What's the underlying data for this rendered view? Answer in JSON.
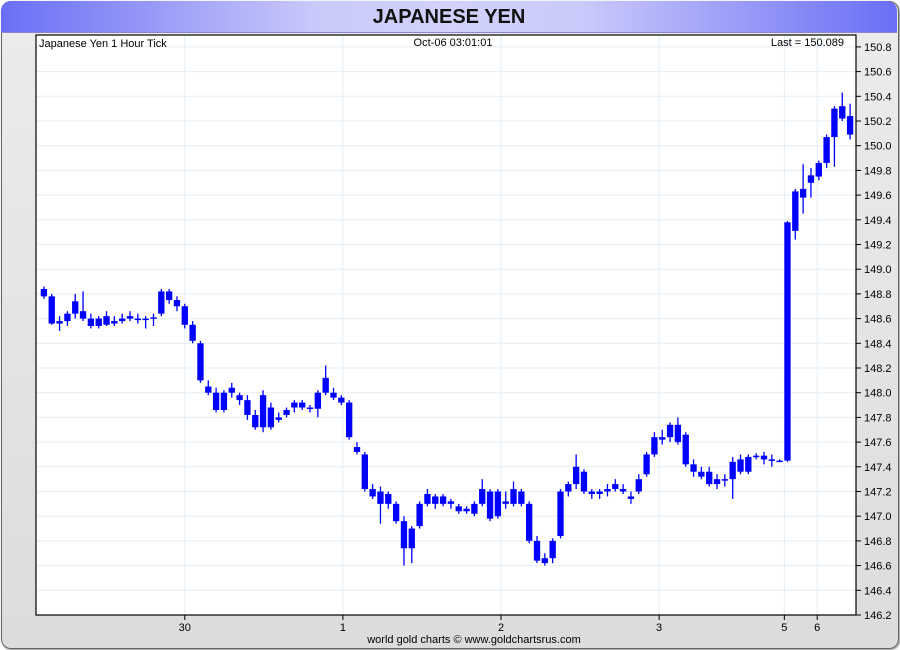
{
  "title": "JAPANESE YEN",
  "chart_data": {
    "type": "candlestick",
    "title": "Japanese Yen 1 Hour Tick",
    "timestamp": "Oct-06  03:01:01",
    "last_label": "Last = 150.089",
    "footer": "world gold charts © www.goldchartsrus.com",
    "ylim": [
      146.2,
      150.9
    ],
    "yticks": [
      "146.2",
      "146.4",
      "146.6",
      "146.8",
      "147.0",
      "147.2",
      "147.4",
      "147.6",
      "147.8",
      "148.0",
      "148.2",
      "148.4",
      "148.6",
      "148.8",
      "149.0",
      "149.2",
      "149.4",
      "149.6",
      "149.8",
      "150.0",
      "150.2",
      "150.4",
      "150.6",
      "150.8"
    ],
    "xticks": [
      {
        "label": "30",
        "index": 18
      },
      {
        "label": "1",
        "index": 38.2
      },
      {
        "label": "2",
        "index": 58.4
      },
      {
        "label": "3",
        "index": 78.6
      },
      {
        "label": "5",
        "index": 94.6
      },
      {
        "label": "6",
        "index": 98.8
      }
    ],
    "color": "#0000ff",
    "candles": [
      [
        148.84,
        148.86,
        148.76,
        148.78
      ],
      [
        148.78,
        148.8,
        148.55,
        148.56
      ],
      [
        148.56,
        148.62,
        148.5,
        148.58
      ],
      [
        148.58,
        148.66,
        148.54,
        148.64
      ],
      [
        148.64,
        148.8,
        148.6,
        148.74
      ],
      [
        148.66,
        148.82,
        148.58,
        148.6
      ],
      [
        148.6,
        148.64,
        148.52,
        148.54
      ],
      [
        148.54,
        148.62,
        148.52,
        148.6
      ],
      [
        148.62,
        148.66,
        148.54,
        148.55
      ],
      [
        148.56,
        148.62,
        148.54,
        148.58
      ],
      [
        148.58,
        148.64,
        148.56,
        148.6
      ],
      [
        148.6,
        148.66,
        148.58,
        148.62
      ],
      [
        148.6,
        148.64,
        148.56,
        148.6
      ],
      [
        148.6,
        148.62,
        148.52,
        148.6
      ],
      [
        148.6,
        148.64,
        148.54,
        148.61
      ],
      [
        148.64,
        148.84,
        148.62,
        148.82
      ],
      [
        148.82,
        148.84,
        148.72,
        148.75
      ],
      [
        148.75,
        148.78,
        148.66,
        148.7
      ],
      [
        148.7,
        148.72,
        148.52,
        148.55
      ],
      [
        148.55,
        148.58,
        148.4,
        148.42
      ],
      [
        148.4,
        148.42,
        148.08,
        148.1
      ],
      [
        148.05,
        148.1,
        147.98,
        148.0
      ],
      [
        148.0,
        148.04,
        147.84,
        147.86
      ],
      [
        147.86,
        148.02,
        147.84,
        148.0
      ],
      [
        148.0,
        148.08,
        147.96,
        148.04
      ],
      [
        147.98,
        148.0,
        147.9,
        147.94
      ],
      [
        147.94,
        147.98,
        147.78,
        147.82
      ],
      [
        147.82,
        147.86,
        147.7,
        147.72
      ],
      [
        147.98,
        148.02,
        147.68,
        147.72
      ],
      [
        147.72,
        147.92,
        147.7,
        147.88
      ],
      [
        147.78,
        147.84,
        147.76,
        147.8
      ],
      [
        147.82,
        147.88,
        147.8,
        147.86
      ],
      [
        147.88,
        147.94,
        147.84,
        147.92
      ],
      [
        147.92,
        147.94,
        147.86,
        147.88
      ],
      [
        147.88,
        147.9,
        147.84,
        147.87
      ],
      [
        147.87,
        148.02,
        147.8,
        148.0
      ],
      [
        148.0,
        148.22,
        147.98,
        148.12
      ],
      [
        148.0,
        148.04,
        147.94,
        147.96
      ],
      [
        147.96,
        147.98,
        147.9,
        147.92
      ],
      [
        147.92,
        147.94,
        147.62,
        147.64
      ],
      [
        147.56,
        147.6,
        147.5,
        147.52
      ],
      [
        147.5,
        147.52,
        147.2,
        147.22
      ],
      [
        147.22,
        147.26,
        147.14,
        147.16
      ],
      [
        147.2,
        147.24,
        146.94,
        147.1
      ],
      [
        147.1,
        147.2,
        147.06,
        147.18
      ],
      [
        147.1,
        147.12,
        146.94,
        146.96
      ],
      [
        146.96,
        147.0,
        146.6,
        146.74
      ],
      [
        146.74,
        146.92,
        146.62,
        146.9
      ],
      [
        146.92,
        147.12,
        146.9,
        147.1
      ],
      [
        147.1,
        147.22,
        147.08,
        147.18
      ],
      [
        147.1,
        147.18,
        147.06,
        147.16
      ],
      [
        147.16,
        147.18,
        147.08,
        147.1
      ],
      [
        147.1,
        147.14,
        147.06,
        147.12
      ],
      [
        147.08,
        147.1,
        147.02,
        147.04
      ],
      [
        147.04,
        147.08,
        147.02,
        147.06
      ],
      [
        147.02,
        147.12,
        147.0,
        147.1
      ],
      [
        147.1,
        147.3,
        147.08,
        147.22
      ],
      [
        147.2,
        147.22,
        146.96,
        146.98
      ],
      [
        147.0,
        147.22,
        146.98,
        147.2
      ],
      [
        147.1,
        147.2,
        147.06,
        147.12
      ],
      [
        147.1,
        147.28,
        147.08,
        147.22
      ],
      [
        147.2,
        147.22,
        147.08,
        147.1
      ],
      [
        147.1,
        147.12,
        146.78,
        146.8
      ],
      [
        146.8,
        146.84,
        146.62,
        146.64
      ],
      [
        146.62,
        146.7,
        146.6,
        146.66
      ],
      [
        146.66,
        146.82,
        146.62,
        146.8
      ],
      [
        146.84,
        147.22,
        146.82,
        147.2
      ],
      [
        147.2,
        147.28,
        147.16,
        147.26
      ],
      [
        147.26,
        147.5,
        147.22,
        147.4
      ],
      [
        147.36,
        147.38,
        147.18,
        147.2
      ],
      [
        147.2,
        147.22,
        147.14,
        147.18
      ],
      [
        147.18,
        147.22,
        147.14,
        147.2
      ],
      [
        147.2,
        147.26,
        147.16,
        147.22
      ],
      [
        147.26,
        147.3,
        147.2,
        147.22
      ],
      [
        147.22,
        147.26,
        147.18,
        147.2
      ],
      [
        147.16,
        147.2,
        147.1,
        147.14
      ],
      [
        147.2,
        147.34,
        147.18,
        147.3
      ],
      [
        147.34,
        147.52,
        147.32,
        147.5
      ],
      [
        147.5,
        147.68,
        147.48,
        147.64
      ],
      [
        147.64,
        147.7,
        147.58,
        147.62
      ],
      [
        147.64,
        147.76,
        147.6,
        147.74
      ],
      [
        147.74,
        147.8,
        147.58,
        147.6
      ],
      [
        147.66,
        147.68,
        147.4,
        147.42
      ],
      [
        147.42,
        147.46,
        147.32,
        147.36
      ],
      [
        147.32,
        147.4,
        147.3,
        147.36
      ],
      [
        147.36,
        147.4,
        147.24,
        147.26
      ],
      [
        147.26,
        147.34,
        147.22,
        147.3
      ],
      [
        147.3,
        147.34,
        147.24,
        147.3
      ],
      [
        147.3,
        147.48,
        147.14,
        147.44
      ],
      [
        147.46,
        147.5,
        147.34,
        147.36
      ],
      [
        147.36,
        147.5,
        147.34,
        147.48
      ],
      [
        147.48,
        147.51,
        147.46,
        147.49
      ],
      [
        147.49,
        147.52,
        147.42,
        147.46
      ],
      [
        147.46,
        147.5,
        147.4,
        147.45
      ],
      [
        147.45,
        147.46,
        147.44,
        147.45
      ],
      [
        147.45,
        149.39,
        147.44,
        149.38
      ],
      [
        149.31,
        149.65,
        149.24,
        149.63
      ],
      [
        149.58,
        149.85,
        149.45,
        149.65
      ],
      [
        149.7,
        149.82,
        149.58,
        149.76
      ],
      [
        149.75,
        149.88,
        149.72,
        149.86
      ],
      [
        149.86,
        150.09,
        149.82,
        150.07
      ],
      [
        150.07,
        150.32,
        149.83,
        150.3
      ],
      [
        150.22,
        150.43,
        150.2,
        150.32
      ],
      [
        150.24,
        150.34,
        150.05,
        150.09
      ]
    ]
  }
}
